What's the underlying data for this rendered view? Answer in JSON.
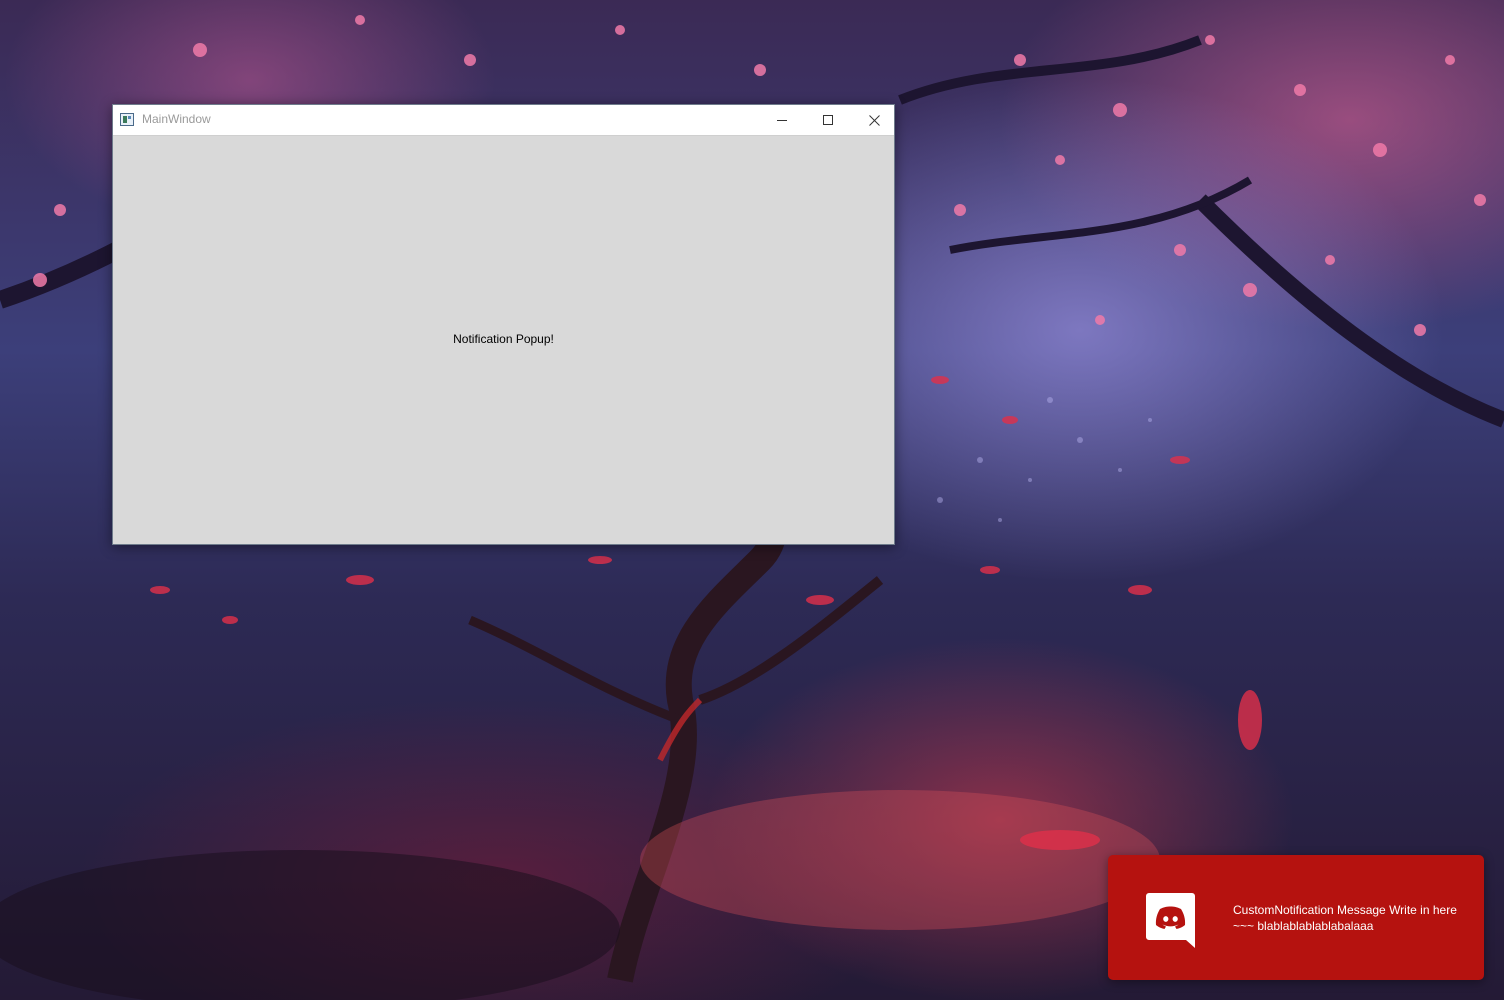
{
  "window": {
    "title": "MainWindow",
    "label": "Notification Popup!"
  },
  "notification": {
    "icon": "discord-icon",
    "message": "CustomNotification Message Write in here ~~~ blablablablablabalaaa",
    "background": "#b5120f"
  }
}
